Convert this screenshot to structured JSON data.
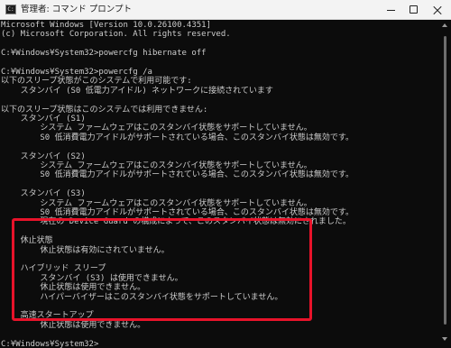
{
  "window": {
    "title": "管理者: コマンド プロンプト",
    "icon": "cmd-icon",
    "controls": [
      "minimize-icon",
      "maximize-icon",
      "close-icon"
    ]
  },
  "console": {
    "lines": [
      "Microsoft Windows [Version 10.0.26100.4351]",
      "(c) Microsoft Corporation. All rights reserved.",
      "",
      "C:¥Windows¥System32>powercfg hibernate off",
      "",
      "C:¥Windows¥System32>powercfg /a",
      "以下のスリープ状態がこのシステムで利用可能です:",
      "    スタンバイ (S0 低電力アイドル) ネットワークに接続されています",
      "",
      "以下のスリープ状態はこのシステムでは利用できません:",
      "    スタンバイ (S1)",
      "        システム ファームウェアはこのスタンバイ状態をサポートしていません。",
      "        S0 低消費電力アイドルがサポートされている場合、このスタンバイ状態は無効です。",
      "",
      "    スタンバイ (S2)",
      "        システム ファームウェアはこのスタンバイ状態をサポートしていません。",
      "        S0 低消費電力アイドルがサポートされている場合、このスタンバイ状態は無効です。",
      "",
      "    スタンバイ (S3)",
      "        システム ファームウェアはこのスタンバイ状態をサポートしていません。",
      "        S0 低消費電力アイドルがサポートされている場合、このスタンバイ状態は無効です。",
      "        現在の Device Guard の構成によって、このスタンバイ状態は無効にされました。",
      "",
      "    休止状態",
      "        休止状態は有効にされていません。",
      "",
      "    ハイブリッド スリープ",
      "        スタンバイ (S3) は使用できません。",
      "        休止状態は使用できません。",
      "        ハイパーバイザーはこのスタンバイ状態をサポートしていません。",
      "",
      "    高速スタートアップ",
      "        休止状態は使用できません。",
      "",
      "C:¥Windows¥System32>"
    ]
  },
  "colors": {
    "console_background": "#0c0c0c",
    "console_text": "#cccccc",
    "highlight": "#e8132a"
  }
}
